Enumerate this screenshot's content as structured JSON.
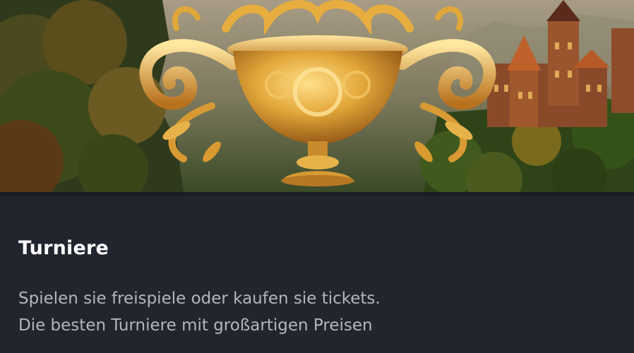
{
  "card": {
    "title": "Turniere",
    "description_lines": [
      "Spielen sie freispiele oder kaufen sie tickets.",
      "Die besten Turniere mit großartigen Preisen"
    ]
  },
  "banner": {
    "icon": "golden-trophy-cup-icon",
    "scene": "forest-castle"
  },
  "colors": {
    "background": "#22252e",
    "title": "#ffffff",
    "text": "#b3b6bf",
    "accent_gold": "#e0a83a"
  }
}
